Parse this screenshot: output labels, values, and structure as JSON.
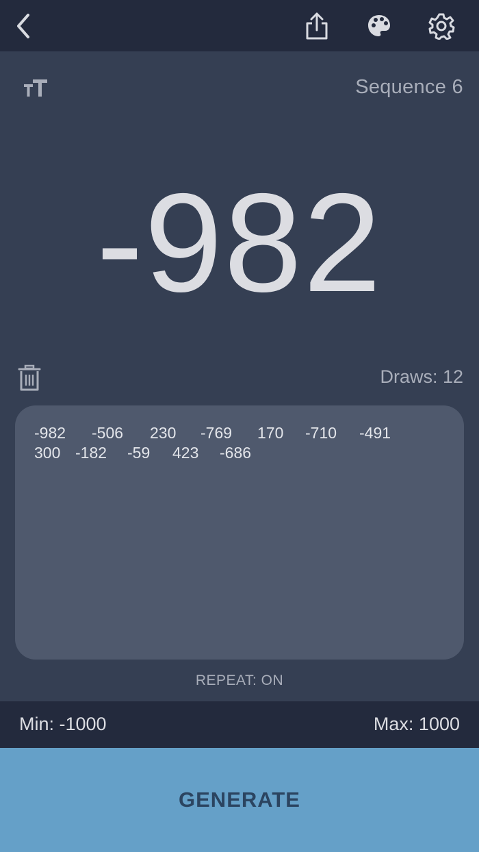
{
  "toolbar": {
    "back_icon": "chevron-left-icon",
    "share_icon": "share-icon",
    "palette_icon": "palette-icon",
    "settings_icon": "gear-icon"
  },
  "main": {
    "text_size_icon": "text-size-icon",
    "sequence_label": "Sequence 6",
    "current_number": "-982",
    "trash_icon": "trash-icon",
    "draws_label": "Draws: 12",
    "history": [
      "-982",
      "-506",
      "230",
      "-769",
      "170",
      "-710",
      "-491",
      "300",
      "-182",
      "-59",
      "423",
      "-686"
    ],
    "repeat_label": "REPEAT: ON"
  },
  "range": {
    "min_label": "Min: -1000",
    "max_label": "Max: 1000"
  },
  "generate": {
    "label": "GENERATE"
  },
  "colors": {
    "topbar_bg": "#232a3d",
    "main_bg": "#353f53",
    "history_bg": "#4f596d",
    "accent": "#65a0c8",
    "generate_text": "#2b4460"
  }
}
